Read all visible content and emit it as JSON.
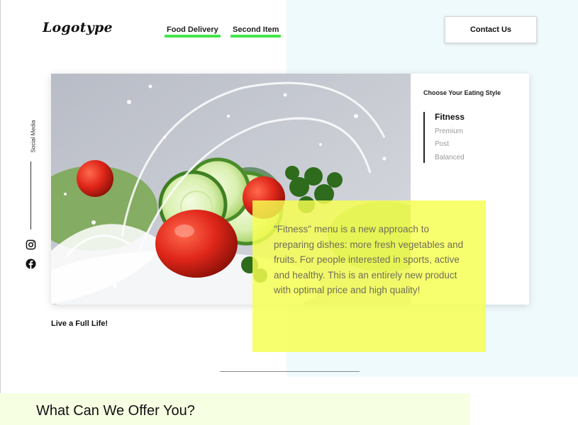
{
  "header": {
    "logo": "Logotype",
    "nav": [
      {
        "label": "Food Delivery"
      },
      {
        "label": "Second Item"
      }
    ],
    "contact_label": "Contact Us",
    "accent_color": "#43e54b"
  },
  "social": {
    "label": "Social Media",
    "icons": [
      "instagram-icon",
      "facebook-icon"
    ]
  },
  "card": {
    "hero_image": "salad-splash-image",
    "eating_style": {
      "title": "Choose Your Eating Style",
      "options": [
        {
          "label": "Fitness",
          "selected": true
        },
        {
          "label": "Premium",
          "selected": false
        },
        {
          "label": "Post",
          "selected": false
        },
        {
          "label": "Balanced",
          "selected": false
        }
      ]
    },
    "description": "\"Fitness\" menu is a new approach to preparing dishes: more fresh vegetables and fruits. For people interested in sports, active and healthy. This is an entirely new product with optimal price and high quality!",
    "highlight_color": "#f7ff50"
  },
  "tagline": "Live a Full Life!",
  "offer": {
    "title": "What Can We Offer You?"
  }
}
